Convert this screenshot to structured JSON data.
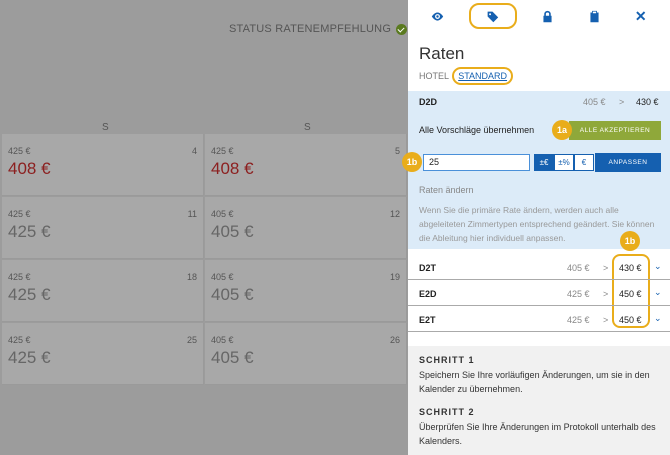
{
  "calendar": {
    "status_label": "STATUS RATENEMPFEHLUNG",
    "day_headers": [
      "S",
      "S"
    ],
    "cells": [
      {
        "small": "425 €",
        "num": "4",
        "big": "408 €",
        "red": true
      },
      {
        "small": "425 €",
        "num": "5",
        "big": "408 €",
        "red": true
      },
      {
        "small": "425 €",
        "num": "11",
        "big": "425 €",
        "red": false
      },
      {
        "small": "405 €",
        "num": "12",
        "big": "405 €",
        "red": false
      },
      {
        "small": "425 €",
        "num": "18",
        "big": "425 €",
        "red": false
      },
      {
        "small": "405 €",
        "num": "19",
        "big": "405 €",
        "red": false
      },
      {
        "small": "425 €",
        "num": "25",
        "big": "425 €",
        "red": false
      },
      {
        "small": "405 €",
        "num": "26",
        "big": "405 €",
        "red": false
      }
    ]
  },
  "panel": {
    "tabs": [
      "eye-icon",
      "tag-icon",
      "lock-icon",
      "clipboard-icon",
      "close-icon"
    ],
    "title": "Raten",
    "hotel_label": "HOTEL",
    "hotel_link": "STANDARD",
    "primary": {
      "code": "D2D",
      "old": "405 €",
      "arrow": ">",
      "new": "430 €"
    },
    "accept_all_label": "Alle Vorschläge übernehmen",
    "accept_button": "ALLE AKZEPTIEREN",
    "badge_1a": "1a",
    "badge_1b": "1b",
    "rate_value": "25",
    "modes": [
      "±€",
      "±%",
      "€"
    ],
    "apply_button": "ANPASSEN",
    "change_rates_label": "Raten ändern",
    "info_text": "Wenn Sie die primäre Rate ändern, werden auch alle abgeleiteten Zimmertypen entsprechend geändert. Sie können die Ableitung hier individuell anpassen.",
    "derived": [
      {
        "code": "D2T",
        "old": "405 €",
        "arrow": ">",
        "new": "430 €",
        "chev": "⌄"
      },
      {
        "code": "E2D",
        "old": "425 €",
        "arrow": ">",
        "new": "450 €",
        "chev": "⌄"
      },
      {
        "code": "E2T",
        "old": "425 €",
        "arrow": ">",
        "new": "450 €",
        "chev": "⌄"
      }
    ],
    "steps": [
      {
        "title": "SCHRITT 1",
        "text": "Speichern Sie Ihre vorläufigen Änderungen, um sie in den Kalender zu übernehmen."
      },
      {
        "title": "SCHRITT 2",
        "text": "Überprüfen Sie Ihre Änderungen im Protokoll unterhalb des Kalenders."
      }
    ],
    "colors": {
      "accent": "#1560b0",
      "highlight": "#e9ad1b",
      "accept": "#8fa83a"
    }
  }
}
